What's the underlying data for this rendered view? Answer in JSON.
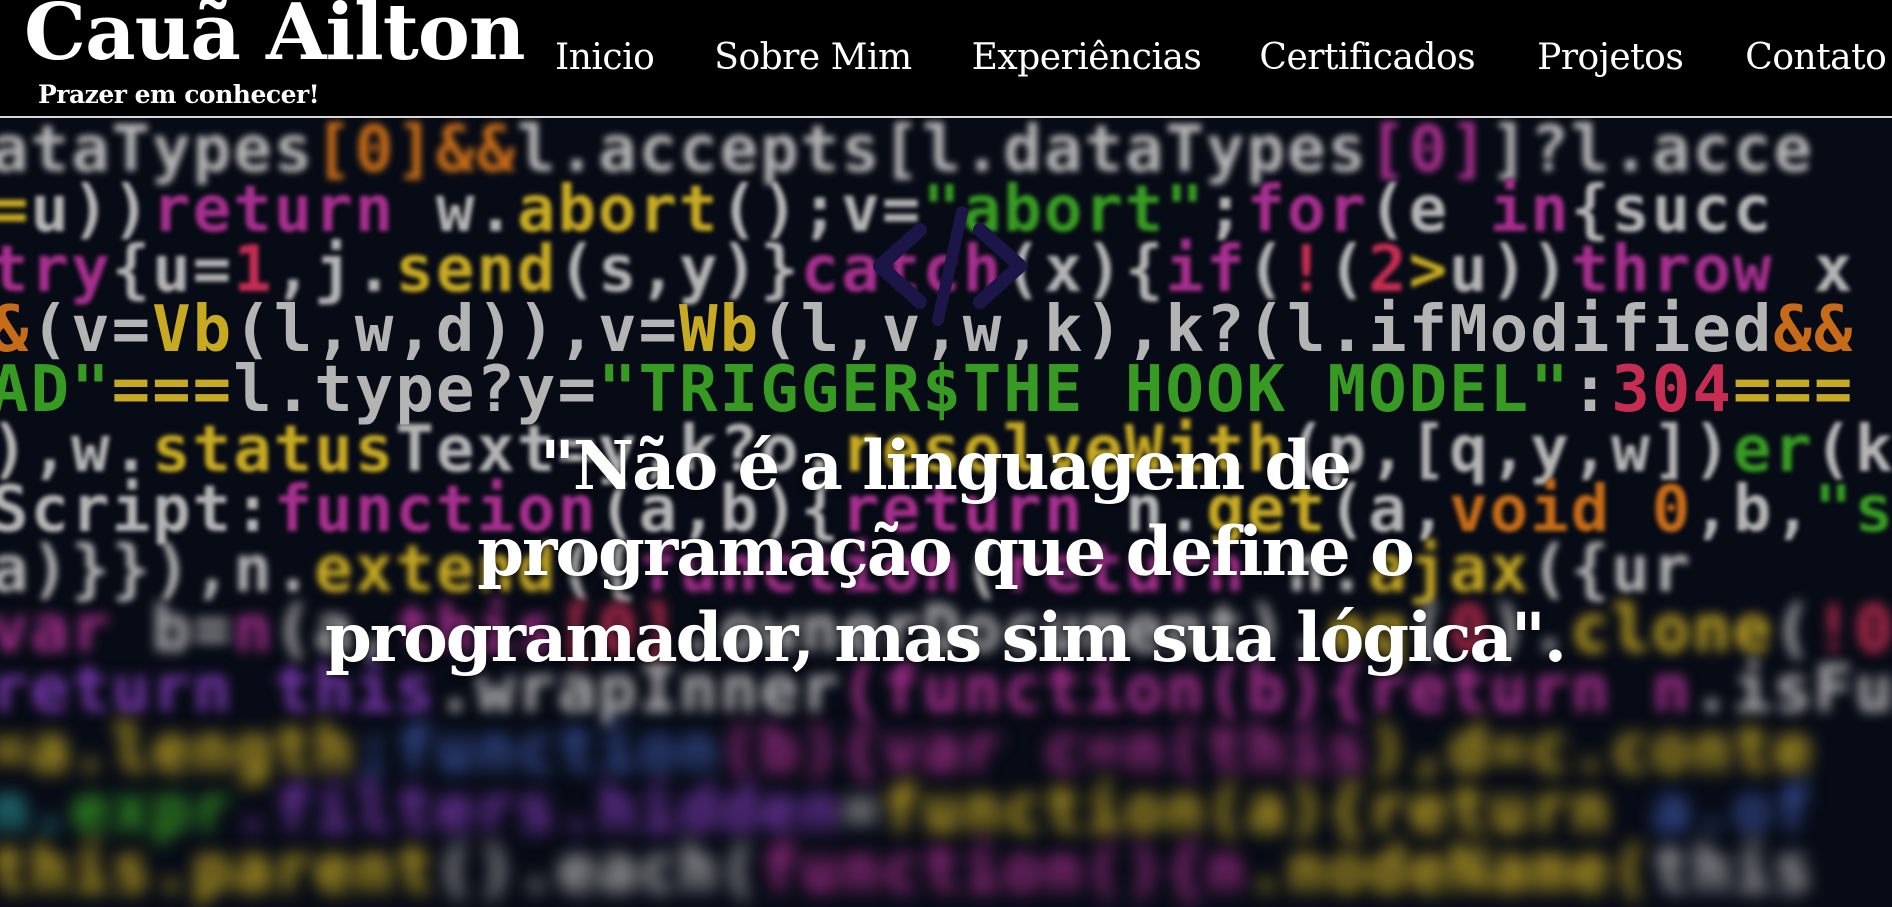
{
  "header": {
    "brand_name": "Cauã Ailton",
    "tagline": "Prazer em conhecer!",
    "nav": {
      "inicio": "Inicio",
      "sobre": "Sobre Mim",
      "experiencias": "Experiências",
      "certificados": "Certificados",
      "projetos": "Projetos",
      "contato": "Contato"
    }
  },
  "hero": {
    "icon": "code-brackets-icon",
    "icon_color": "#1c1547",
    "quote": "\"Não é a linguagem de programação que define o programador, mas sim sua lógica\"."
  },
  "colors": {
    "header_bg": "#000000",
    "header_border": "#d9d9d9",
    "text": "#ffffff"
  }
}
